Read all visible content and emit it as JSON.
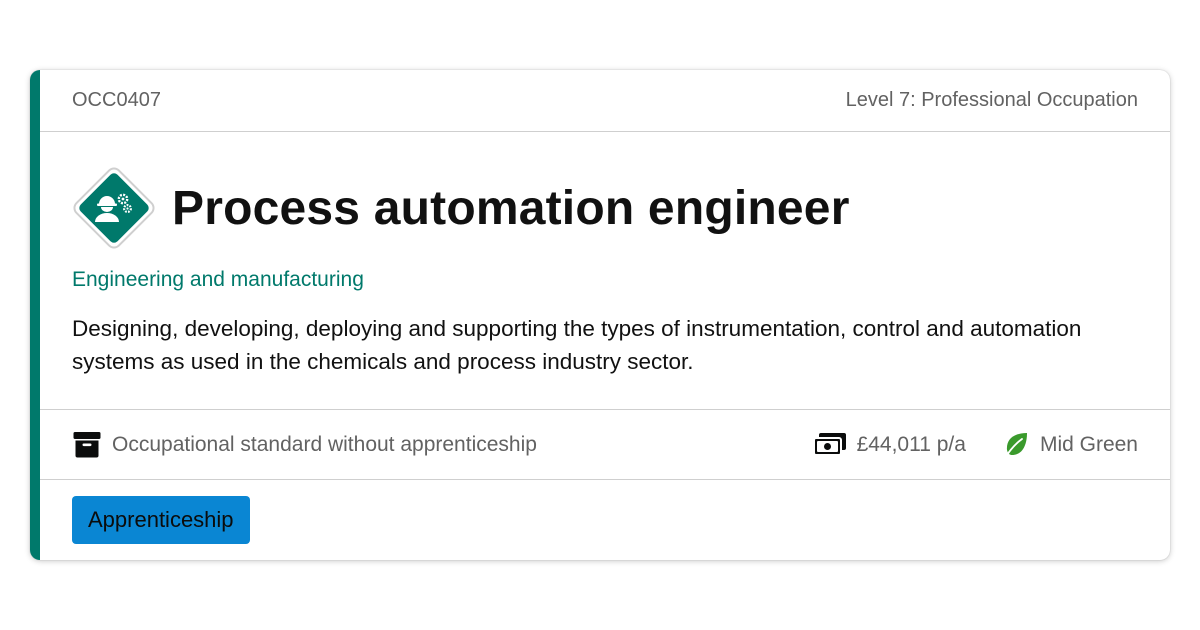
{
  "card": {
    "code": "OCC0407",
    "level": "Level 7: Professional Occupation",
    "title": "Process automation engineer",
    "route": "Engineering and manufacturing",
    "description": "Designing, developing, deploying and supporting the types of instrumentation, control and automation systems as used in the chemicals and process industry sector.",
    "standard_type": "Occupational standard without apprenticeship",
    "salary": "£44,011 p/a",
    "green_rating": "Mid Green",
    "tag": "Apprenticeship",
    "icons": {
      "occupation": "engineer-gears-icon",
      "standard": "archive-box-icon",
      "salary": "money-icon",
      "green": "leaf-icon"
    }
  },
  "colors": {
    "accent": "#00796b",
    "route_text": "#00796b",
    "leaf": "#3a9a2c",
    "tag_bg": "#0a86d3"
  }
}
